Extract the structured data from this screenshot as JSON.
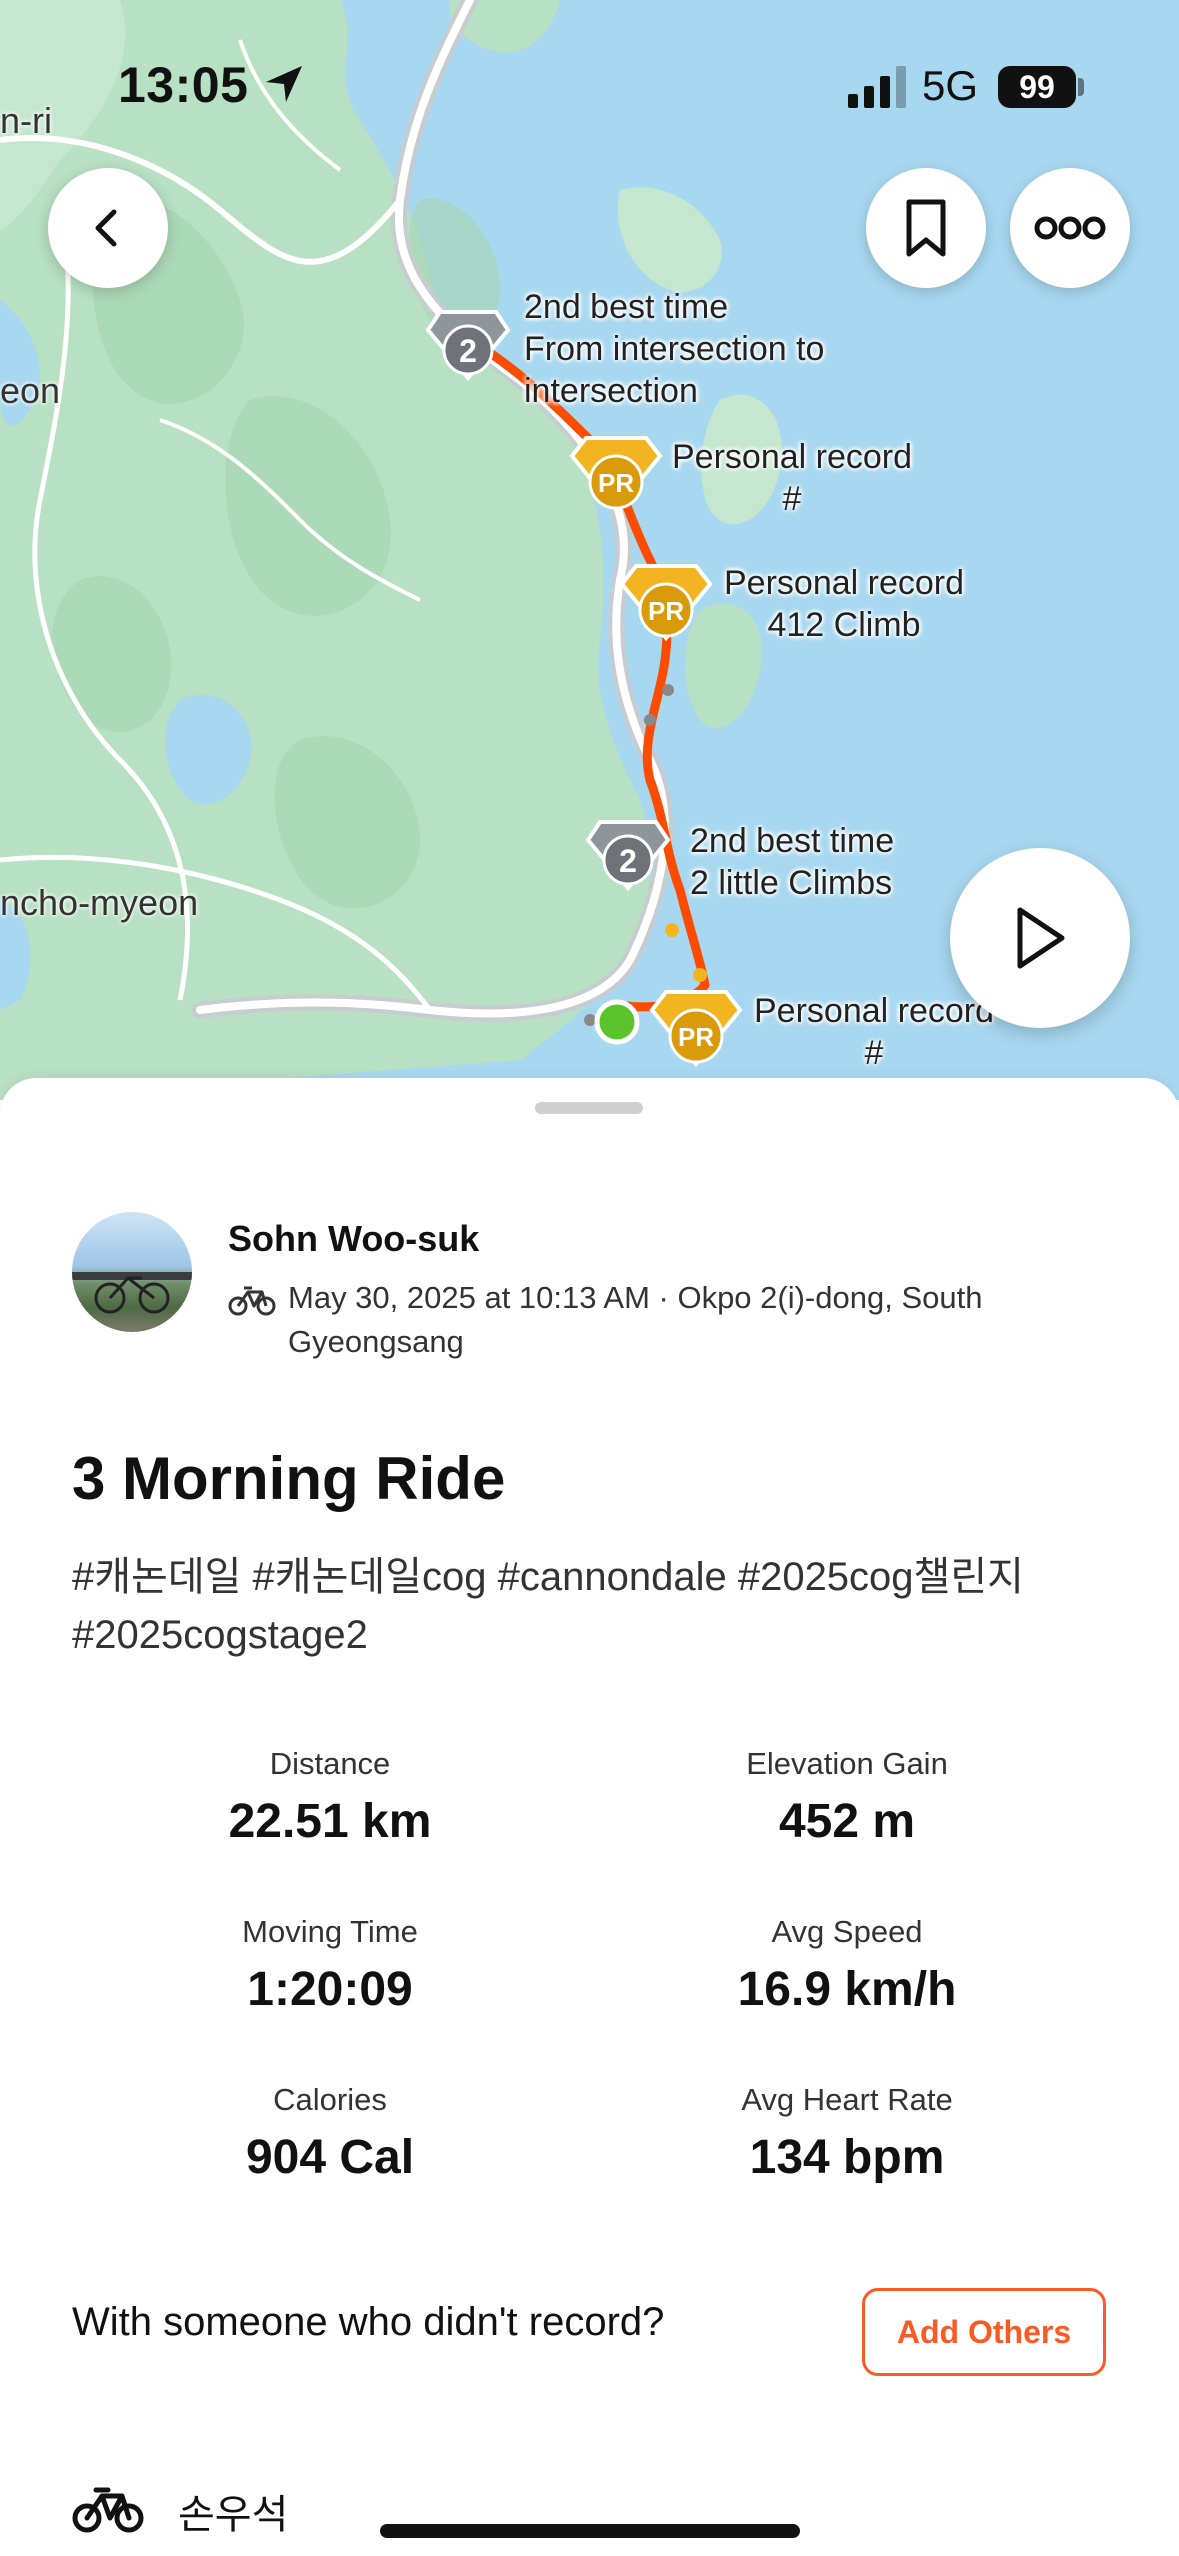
{
  "status_bar": {
    "time": "13:05",
    "network": "5G",
    "battery": "99"
  },
  "map": {
    "places": [
      "n-ri",
      "eon",
      "ncho-myeon"
    ],
    "labels": [
      {
        "line1": "2nd best time",
        "line2": "From intersection to",
        "line3": "intersection",
        "badge": "2"
      },
      {
        "line1": "Personal record",
        "line2": "#",
        "badge": "PR"
      },
      {
        "line1": "Personal record",
        "line2": "412 Climb",
        "badge": "PR"
      },
      {
        "line1": "2nd best time",
        "line2": "2 little Climbs",
        "badge": "2"
      },
      {
        "line1": "Personal record",
        "line2": "#",
        "badge": "PR"
      }
    ],
    "colors": {
      "water": "#a8d8f0",
      "land": "#b8e0c2",
      "route": "#fc4c02",
      "gold_badge": "#f2b521",
      "silver_badge": "#8e959b",
      "start": "#5cc42b"
    }
  },
  "activity": {
    "athlete": "Sohn Woo-suk",
    "meta": "May 30, 2025 at 10:13 AM · Okpo 2(i)-dong, South Gyeongsang",
    "title": "3 Morning Ride",
    "description": "#캐논데일 #캐논데일cog #cannondale #2025cog챌린지 #2025cogstage2"
  },
  "stats": [
    {
      "label": "Distance",
      "value": "22.51 km"
    },
    {
      "label": "Elevation Gain",
      "value": "452 m"
    },
    {
      "label": "Moving Time",
      "value": "1:20:09"
    },
    {
      "label": "Avg Speed",
      "value": "16.9 km/h"
    },
    {
      "label": "Calories",
      "value": "904 Cal"
    },
    {
      "label": "Avg Heart Rate",
      "value": "134 bpm"
    }
  ],
  "with_others": {
    "prompt": "With someone who didn't record?",
    "button": "Add Others"
  },
  "gear": {
    "name": "손우석"
  }
}
